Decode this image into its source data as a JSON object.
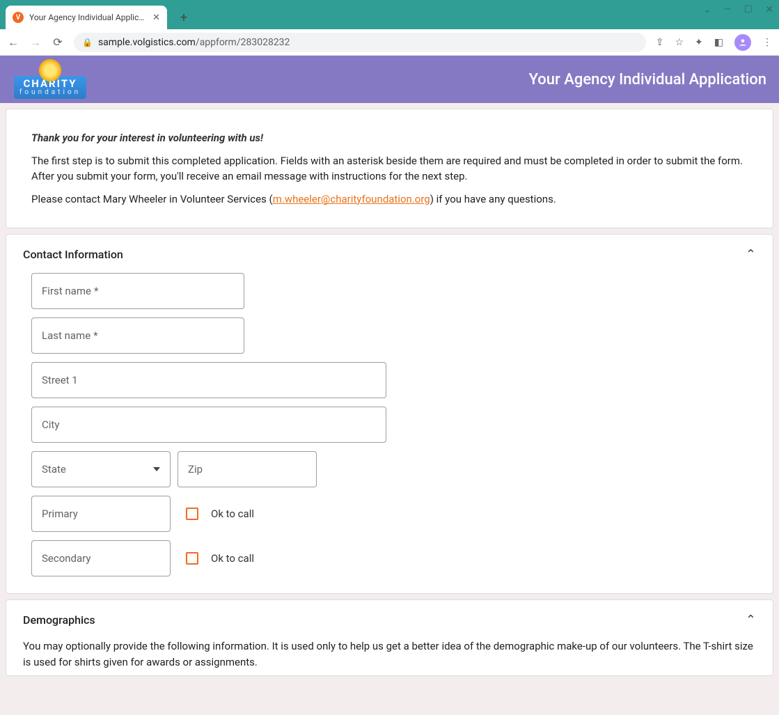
{
  "browser": {
    "tab_title": "Your Agency Individual Applicati",
    "url_domain": "sample.volgistics.com",
    "url_path": "/appform/283028232"
  },
  "banner": {
    "logo_line1": "CHARITY",
    "logo_line2": "foundation",
    "title": "Your Agency Individual Application"
  },
  "intro": {
    "lead": "Thank you for your interest in volunteering with us!",
    "p1": "The first step is to submit this completed application. Fields with an asterisk beside them are required and must be completed in order to submit the form. After you submit your form, you'll receive an email message with instructions for the next step.",
    "p2a": "Please contact Mary Wheeler in Volunteer Services (",
    "email": "m.wheeler@charityfoundation.org",
    "p2b": ") if you have any questions."
  },
  "sections": {
    "contact": {
      "title": "Contact Information",
      "first_name": "First name",
      "last_name": "Last name",
      "street1": "Street 1",
      "city": "City",
      "state": "State",
      "zip": "Zip",
      "primary": "Primary",
      "secondary": "Secondary",
      "ok_to_call": "Ok to call",
      "required_mark": "*"
    },
    "demographics": {
      "title": "Demographics",
      "text": "You may optionally provide the following information. It is used only to help us get a better idea of the demographic make-up of our volunteers. The T-shirt size is used for shirts given for awards or assignments."
    }
  }
}
